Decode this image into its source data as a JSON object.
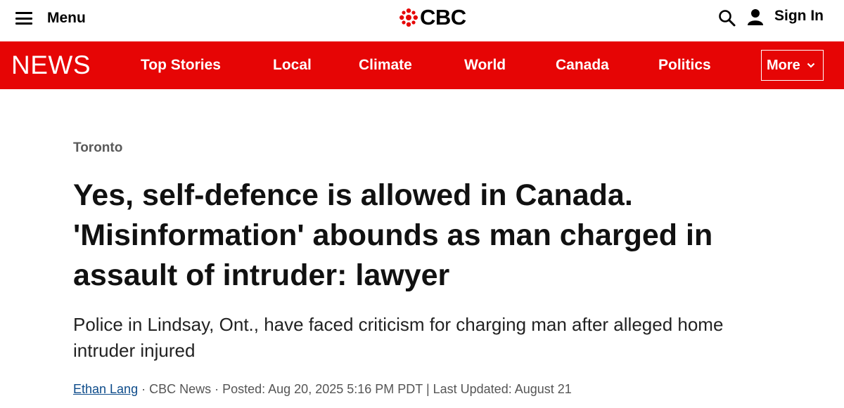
{
  "header": {
    "menu_label": "Menu",
    "logo_text": "CBC",
    "signin_label": "Sign In",
    "brand_color": "#e60505"
  },
  "nav": {
    "news_label": "NEWS",
    "items": [
      "Top Stories",
      "Local",
      "Climate",
      "World",
      "Canada",
      "Politics"
    ],
    "more_label": "More"
  },
  "article": {
    "section": "Toronto",
    "headline": "Yes, self-defence is allowed in Canada. 'Misinformation' abounds as man charged in assault of intruder: lawyer",
    "deck": "Police in Lindsay, Ont., have faced criticism for charging man after alleged home intruder injured",
    "byline": {
      "author": "Ethan Lang",
      "meta": " · CBC News · Posted: Aug 20, 2025 5:16 PM PDT | Last Updated: August 21"
    }
  }
}
